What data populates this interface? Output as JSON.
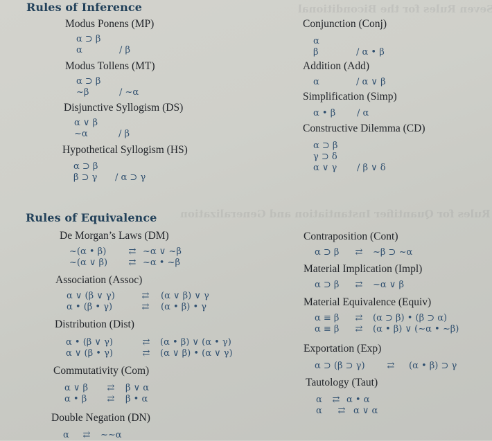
{
  "inference": {
    "title": "Rules of Inference",
    "rules": {
      "mp": {
        "name": "Modus Ponens (MP)",
        "premises": [
          "α ⊃ β",
          "α"
        ],
        "conclusion": "/ β"
      },
      "mt": {
        "name": "Modus Tollens (MT)",
        "premises": [
          "α ⊃ β",
          "~β"
        ],
        "conclusion": "/ ~α"
      },
      "ds": {
        "name": "Disjunctive Syllogism (DS)",
        "premises": [
          "α ∨ β",
          "~α"
        ],
        "conclusion": "/ β"
      },
      "hs": {
        "name": "Hypothetical Syllogism (HS)",
        "premises": [
          "α ⊃ β",
          "β ⊃ γ"
        ],
        "conclusion": "/ α ⊃ γ"
      },
      "conj": {
        "name": "Conjunction (Conj)",
        "premises": [
          "α",
          "β"
        ],
        "conclusion": "/ α • β"
      },
      "add": {
        "name": "Addition (Add)",
        "premises": [
          "α"
        ],
        "conclusion": "/ α ∨ β"
      },
      "simp": {
        "name": "Simplification (Simp)",
        "premises": [
          "α • β"
        ],
        "conclusion": "/ α"
      },
      "cd": {
        "name": "Constructive Dilemma (CD)",
        "premises": [
          "α ⊃ β",
          "γ ⊃ δ",
          "α ∨ γ"
        ],
        "conclusion": "/ β ∨ δ"
      }
    }
  },
  "equivalence": {
    "title": "Rules of Equivalence",
    "arrow": "⇄",
    "rules": {
      "dm": {
        "name": "De Morgan’s Laws (DM)",
        "rows": [
          {
            "lhs": "~(α • β)",
            "rhs": "~α ∨ ~β"
          },
          {
            "lhs": "~(α ∨ β)",
            "rhs": "~α • ~β"
          }
        ]
      },
      "assoc": {
        "name": "Association (Assoc)",
        "rows": [
          {
            "lhs": "α ∨ (β ∨ γ)",
            "rhs": "(α ∨ β) ∨ γ"
          },
          {
            "lhs": "α • (β • γ)",
            "rhs": "(α • β) • γ"
          }
        ]
      },
      "dist": {
        "name": "Distribution (Dist)",
        "rows": [
          {
            "lhs": "α • (β ∨ γ)",
            "rhs": "(α • β) ∨ (α • γ)"
          },
          {
            "lhs": "α ∨ (β • γ)",
            "rhs": "(α ∨ β) • (α ∨ γ)"
          }
        ]
      },
      "com": {
        "name": "Commutativity (Com)",
        "rows": [
          {
            "lhs": "α ∨ β",
            "rhs": "β ∨ α"
          },
          {
            "lhs": "α • β",
            "rhs": "β • α"
          }
        ]
      },
      "dn": {
        "name": "Double Negation (DN)",
        "rows": [
          {
            "lhs": "α",
            "rhs": "~~α"
          }
        ]
      },
      "cont": {
        "name": "Contraposition (Cont)",
        "rows": [
          {
            "lhs": "α ⊃ β",
            "rhs": "~β ⊃ ~α"
          }
        ]
      },
      "impl": {
        "name": "Material Implication (Impl)",
        "rows": [
          {
            "lhs": "α ⊃ β",
            "rhs": "~α ∨ β"
          }
        ]
      },
      "equiv": {
        "name": "Material Equivalence (Equiv)",
        "rows": [
          {
            "lhs": "α ≡ β",
            "rhs": "(α ⊃ β) • (β ⊃ α)"
          },
          {
            "lhs": "α ≡ β",
            "rhs": "(α • β) ∨ (~α • ~β)"
          }
        ]
      },
      "exp": {
        "name": "Exportation (Exp)",
        "rows": [
          {
            "lhs": "α ⊃ (β ⊃ γ)",
            "rhs": "(α • β) ⊃ γ"
          }
        ]
      },
      "taut": {
        "name": "Tautology (Taut)",
        "rows": [
          {
            "lhs": "α",
            "rhs": "α • α"
          },
          {
            "lhs": "α",
            "rhs": "α ∨ α"
          }
        ]
      }
    }
  },
  "colors": {
    "heading": "#22415a",
    "formula": "#2f4f6f",
    "rule_name": "#22252a",
    "paper": "#cfd0ca"
  }
}
